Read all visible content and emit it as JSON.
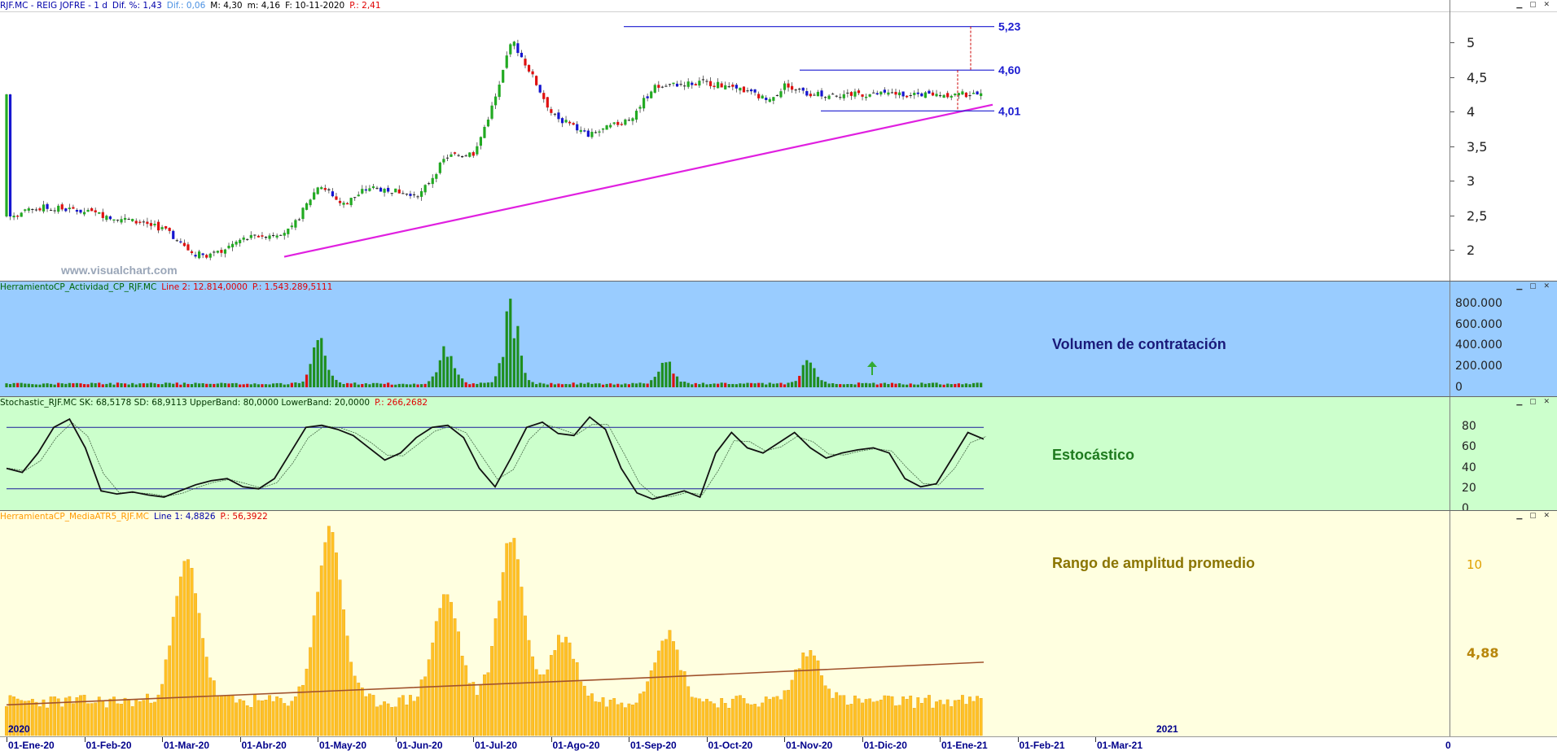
{
  "panes": {
    "price": {
      "header": [
        {
          "text": "RJF.MC - REIG JOFRE -  1 d",
          "color": "#0000aa"
        },
        {
          "text": "Dif. %: 1,43",
          "color": "#0000aa"
        },
        {
          "text": "Dif.: 0,06",
          "color": "#4a90e2"
        },
        {
          "text": "M: 4,30",
          "color": "#000000"
        },
        {
          "text": "m: 4,16",
          "color": "#000000"
        },
        {
          "text": "F: 10-11-2020",
          "color": "#000000"
        },
        {
          "text": "P.: 2,41",
          "color": "#e00000"
        }
      ],
      "watermark": "www.visualchart.com",
      "y_ticks": [
        "2",
        "2,5",
        "3",
        "3,5",
        "4",
        "4,5",
        "5"
      ],
      "levels": [
        {
          "label": "5,23",
          "value": 5.23
        },
        {
          "label": "4,60",
          "value": 4.6
        },
        {
          "label": "4,01",
          "value": 4.01
        }
      ]
    },
    "volume": {
      "header": [
        {
          "text": "HerramientoCP_Actividad_CP_RJF.MC",
          "color": "#006600"
        },
        {
          "text": "Line 2: 12.814,0000",
          "color": "#e00000"
        },
        {
          "text": "P.: 1.543.289,5111",
          "color": "#e00000"
        }
      ],
      "title": "Volumen de contratación",
      "y_ticks": [
        "0",
        "200.000",
        "400.000",
        "600.000",
        "800.000"
      ]
    },
    "stochastic": {
      "header": [
        {
          "text": "Stochastic_RJF.MC  SK: 68,5178  SD: 68,9113  UpperBand: 80,0000  LowerBand: 20,0000",
          "color": "#003300"
        },
        {
          "text": "P.: 266,2682",
          "color": "#e00000"
        }
      ],
      "title": "Estocástico",
      "y_ticks": [
        "0",
        "20",
        "40",
        "60",
        "80"
      ]
    },
    "atr": {
      "header": [
        {
          "text": "HerramientaCP_MediaATR5_RJF.MC",
          "color": "#ff9900"
        },
        {
          "text": "Line 1: 4,8826",
          "color": "#0000aa"
        },
        {
          "text": "P.: 56,3922",
          "color": "#e00000"
        }
      ],
      "title": "Rango de amplitud promedio",
      "y_ticks": [
        "10"
      ],
      "last_value": "4,88"
    }
  },
  "x_axis": {
    "labels": [
      "01-Ene-20",
      "01-Feb-20",
      "01-Mar-20",
      "01-Abr-20",
      "01-May-20",
      "01-Jun-20",
      "01-Jul-20",
      "01-Ago-20",
      "01-Sep-20",
      "01-Oct-20",
      "01-Nov-20",
      "01-Dic-20",
      "01-Ene-21",
      "01-Feb-21",
      "01-Mar-21",
      "0"
    ],
    "years": [
      "2020",
      "2021"
    ]
  },
  "chart_data": [
    {
      "type": "candlestick",
      "title": "RJF.MC - REIG JOFRE",
      "ylim": [
        1.6,
        5.45
      ],
      "trendline": {
        "from": [
          "mid-Mar-20",
          1.9
        ],
        "to": [
          "early-Nov-20",
          4.1
        ],
        "color": "#e020e0"
      },
      "resistance_levels": [
        5.23,
        4.6,
        4.01
      ],
      "close_path": [
        [
          "01-Ene-20",
          2.48
        ],
        [
          "15-Ene-20",
          2.62
        ],
        [
          "01-Feb-20",
          2.55
        ],
        [
          "15-Feb-20",
          2.45
        ],
        [
          "01-Mar-20",
          2.3
        ],
        [
          "12-Mar-20",
          1.95
        ],
        [
          "20-Mar-20",
          1.92
        ],
        [
          "01-Abr-20",
          2.15
        ],
        [
          "20-Abr-20",
          2.28
        ],
        [
          "01-May-20",
          2.95
        ],
        [
          "10-May-20",
          2.65
        ],
        [
          "20-May-20",
          2.9
        ],
        [
          "01-Jun-20",
          2.85
        ],
        [
          "10-Jun-20",
          2.8
        ],
        [
          "20-Jun-20",
          3.35
        ],
        [
          "01-Jul-20",
          3.4
        ],
        [
          "10-Jul-20",
          4.3
        ],
        [
          "15-Jul-20",
          5.05
        ],
        [
          "22-Jul-20",
          4.6
        ],
        [
          "01-Ago-20",
          3.95
        ],
        [
          "15-Ago-20",
          3.65
        ],
        [
          "01-Sep-20",
          3.9
        ],
        [
          "10-Sep-20",
          4.35
        ],
        [
          "20-Sep-20",
          4.4
        ],
        [
          "01-Oct-20",
          4.42
        ],
        [
          "15-Oct-20",
          4.3
        ],
        [
          "25-Oct-20",
          4.15
        ],
        [
          "01-Nov-20",
          4.4
        ],
        [
          "10-Nov-20",
          4.25
        ]
      ]
    },
    {
      "type": "bar",
      "title": "Volumen de contratación",
      "ylim": [
        0,
        900000
      ],
      "peaks": [
        [
          "01-May-20",
          580000
        ],
        [
          "20-Jun-20",
          480000
        ],
        [
          "15-Jul-20",
          840000
        ],
        [
          "15-Sep-20",
          250000
        ],
        [
          "10-Nov-20",
          260000
        ]
      ]
    },
    {
      "type": "line",
      "title": "Estocástico",
      "ylim": [
        0,
        100
      ],
      "bands": [
        80,
        20
      ],
      "series": [
        {
          "name": "SK",
          "values": [
            40,
            36,
            55,
            80,
            88,
            60,
            18,
            15,
            17,
            14,
            12,
            18,
            24,
            28,
            30,
            22,
            20,
            30,
            55,
            80,
            82,
            78,
            72,
            60,
            48,
            55,
            70,
            80,
            82,
            70,
            40,
            22,
            50,
            80,
            85,
            74,
            72,
            90,
            78,
            40,
            16,
            10,
            14,
            18,
            12,
            55,
            75,
            60,
            55,
            65,
            75,
            60,
            50,
            55,
            58,
            60,
            55,
            30,
            22,
            25,
            50,
            75,
            68.5
          ]
        }
      ]
    },
    {
      "type": "bar",
      "title": "Rango de amplitud promedio",
      "ylim": [
        0,
        12.5
      ],
      "peaks": [
        [
          "10-Mar-20",
          10.2
        ],
        [
          "05-May-20",
          12.0
        ],
        [
          "20-Jun-20",
          8.2
        ],
        [
          "15-Jul-20",
          11.5
        ],
        [
          "05-Ago-20",
          5.8
        ],
        [
          "15-Sep-20",
          6.0
        ],
        [
          "10-Nov-20",
          4.88
        ]
      ]
    }
  ]
}
